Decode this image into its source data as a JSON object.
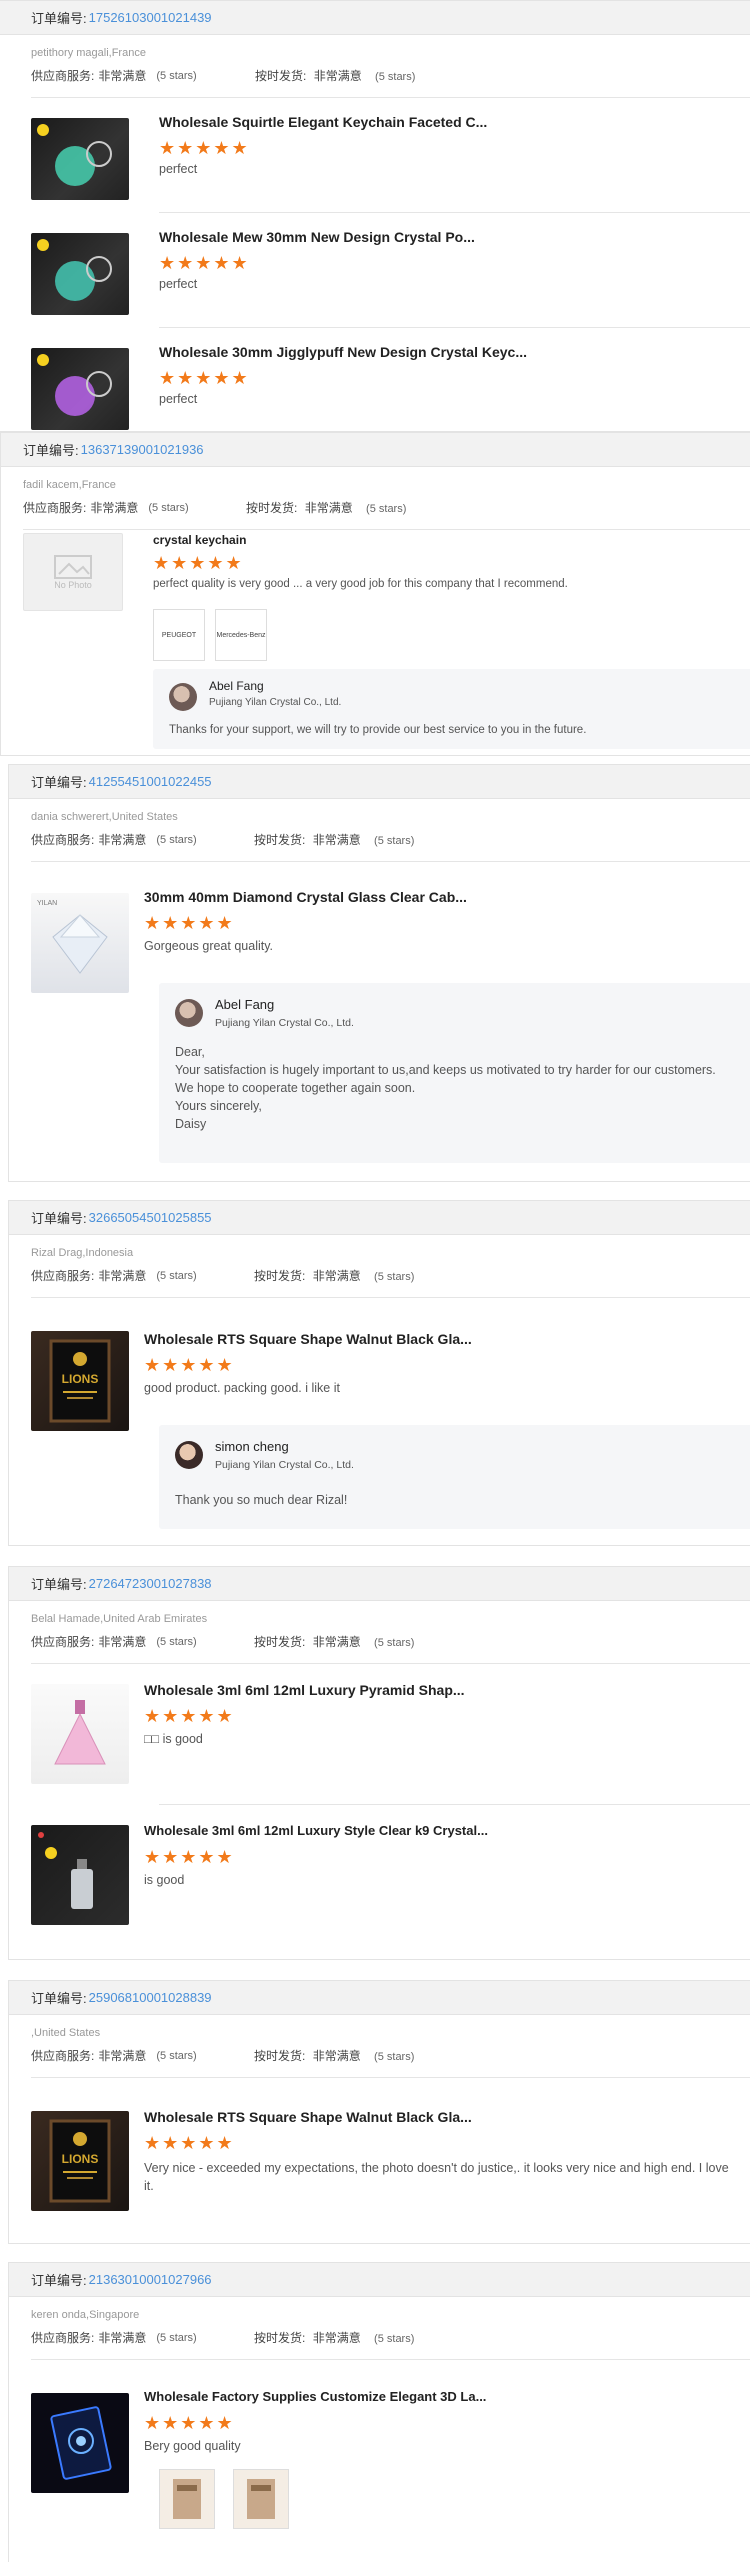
{
  "labels": {
    "order_no": "订单编号:",
    "supplier_service": "供应商服务:",
    "on_time": "按时发货:",
    "very_satisfied": "非常满意",
    "five_stars": "(5 stars)",
    "no_photo": "No Photo",
    "stars": "★★★★★"
  },
  "orders": [
    {
      "number": "17526103001021439",
      "buyer": "petithory magali,France",
      "items": [
        {
          "title": "Wholesale Squirtle Elegant Keychain Faceted C...",
          "comment": "perfect"
        },
        {
          "title": "Wholesale Mew 30mm New Design Crystal Po...",
          "comment": "perfect"
        },
        {
          "title": "Wholesale 30mm Jigglypuff New Design Crystal Keyc...",
          "comment": "perfect"
        }
      ]
    },
    {
      "number": "13637139001021936",
      "buyer": "fadil kacem,France",
      "items": [
        {
          "title": "crystal keychain",
          "comment": "perfect quality is very good ... a very good job for this company that I recommend."
        }
      ],
      "photos": [
        "PEUGEOT",
        "Mercedes-Benz"
      ],
      "reply": {
        "name": "Abel Fang",
        "company": "Pujiang Yilan Crystal Co., Ltd.",
        "body": "Thanks for your support, we will try to provide our best service to you in the future."
      }
    },
    {
      "number": "41255451001022455",
      "buyer": "dania schwerert,United States",
      "items": [
        {
          "title": "30mm 40mm Diamond Crystal Glass Clear Cab...",
          "comment": "Gorgeous great quality."
        }
      ],
      "reply": {
        "name": "Abel Fang",
        "company": "Pujiang Yilan Crystal Co., Ltd.",
        "body": "Dear,\nYour satisfaction is hugely important to us,and keeps us motivated to try harder for our customers.\nWe hope to cooperate together again soon.\nYours sincerely,\nDaisy"
      }
    },
    {
      "number": "32665054501025855",
      "buyer": "Rizal Drag,Indonesia",
      "items": [
        {
          "title": "Wholesale RTS Square Shape Walnut Black Gla...",
          "comment": "good product. packing good. i like it"
        }
      ],
      "reply": {
        "name": "simon cheng",
        "company": "Pujiang Yilan Crystal Co., Ltd.",
        "body": "Thank you so much dear Rizal!"
      }
    },
    {
      "number": "27264723001027838",
      "buyer": "Belal Hamade,United Arab Emirates",
      "items": [
        {
          "title": "Wholesale 3ml 6ml 12ml Luxury Pyramid Shap...",
          "comment": "□□ is good"
        },
        {
          "title": "Wholesale 3ml 6ml 12ml Luxury Style Clear k9 Crystal...",
          "comment": "is good"
        }
      ]
    },
    {
      "number": "25906810001028839",
      "buyer": ",United States",
      "items": [
        {
          "title": "Wholesale RTS Square Shape Walnut Black Gla...",
          "comment": "Very nice - exceeded my expectations, the photo doesn't do justice,. it looks very nice and high end. I love it."
        }
      ]
    },
    {
      "number": "21363010001027966",
      "buyer": "keren onda,Singapore",
      "items": [
        {
          "title": "Wholesale Factory Supplies Customize Elegant 3D La...",
          "comment": "Bery good quality"
        }
      ]
    }
  ],
  "thumb_text": {
    "lions": "LIONS",
    "yilan": "YILAN"
  },
  "colors": {
    "accent_blue": "#4a90d9",
    "star_orange": "#f27a1a",
    "header_bg": "#f2f2f2"
  }
}
